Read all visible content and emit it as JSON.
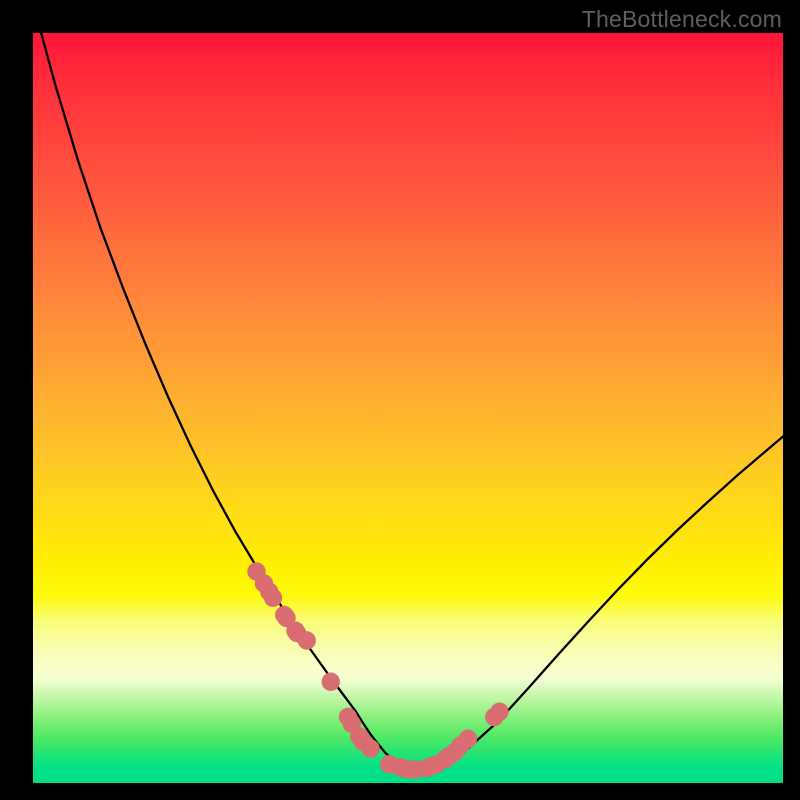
{
  "watermark": "TheBottleneck.com",
  "colors": {
    "dot_fill": "#d96d72",
    "curve_stroke": "#000000",
    "frame_bg": "#000000"
  },
  "chart_data": {
    "type": "line",
    "title": "",
    "xlabel": "",
    "ylabel": "",
    "xlim": [
      0,
      100
    ],
    "ylim": [
      0,
      100
    ],
    "grid": false,
    "series": [
      {
        "name": "bottleneck-curve",
        "x": [
          0,
          3,
          6,
          9,
          12,
          15,
          18,
          21,
          24,
          27,
          30,
          32,
          34,
          36,
          38,
          40,
          41.5,
          43,
          44,
          45,
          46,
          47,
          48,
          49.5,
          51,
          53,
          55,
          58,
          62,
          66,
          70,
          74,
          78,
          82,
          86,
          90,
          94,
          98,
          100
        ],
        "y": [
          104,
          93,
          83,
          74,
          66,
          58.5,
          51.5,
          45,
          39,
          33.5,
          28.5,
          25.3,
          22.2,
          19.2,
          16.4,
          13.6,
          11.6,
          9.6,
          8.0,
          6.5,
          5.2,
          4.0,
          3.1,
          2.2,
          1.8,
          1.9,
          2.8,
          4.6,
          8.2,
          12.6,
          17.1,
          21.5,
          25.8,
          29.9,
          33.8,
          37.5,
          41.1,
          44.5,
          46.2
        ]
      }
    ],
    "scatter_points": {
      "name": "data-markers",
      "x": [
        29.8,
        30.8,
        31.5,
        32.0,
        33.5,
        33.8,
        35.0,
        35.2,
        36.5,
        39.7,
        42.0,
        42.5,
        43.5,
        44.0,
        45.0,
        47.5,
        49.0,
        50.0,
        51.0,
        52.5,
        53.0,
        53.8,
        55.0,
        55.5,
        56.2,
        57.0,
        58.0,
        61.5,
        62.2
      ],
      "y": [
        28.2,
        26.6,
        25.5,
        24.7,
        22.4,
        22.0,
        20.3,
        20.0,
        19.0,
        13.5,
        8.8,
        7.9,
        6.2,
        5.5,
        4.6,
        2.5,
        2.1,
        1.8,
        1.8,
        2.0,
        2.2,
        2.5,
        3.2,
        3.6,
        4.1,
        5.0,
        5.9,
        8.8,
        9.5
      ]
    }
  }
}
